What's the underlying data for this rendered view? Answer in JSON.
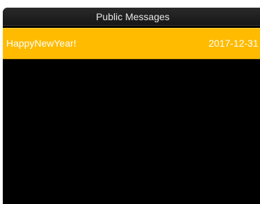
{
  "header": {
    "title": "Public Messages"
  },
  "messages": [
    {
      "text": "HappyNewYear!",
      "date": "2017-12-31"
    }
  ],
  "colors": {
    "background": "#000000",
    "selected_row": "#ffbb00",
    "text": "#ffffff"
  }
}
